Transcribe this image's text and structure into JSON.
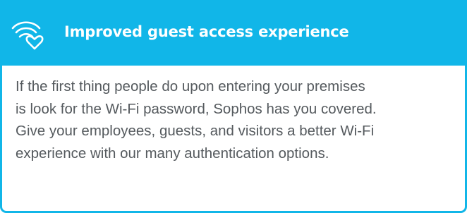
{
  "header": {
    "icon": "wifi-heart-icon",
    "title": "Improved guest access experience",
    "background_color": "#11B6E8",
    "text_color": "#FFFFFF"
  },
  "body": {
    "lines": [
      "If the first thing people do upon entering your premises",
      "is look for the Wi-Fi password, Sophos has you covered.",
      "Give your employees, guests, and visitors a better Wi-Fi",
      "experience with our many authentication options."
    ],
    "text_color": "#555A5E",
    "border_color": "#11B6E8"
  }
}
